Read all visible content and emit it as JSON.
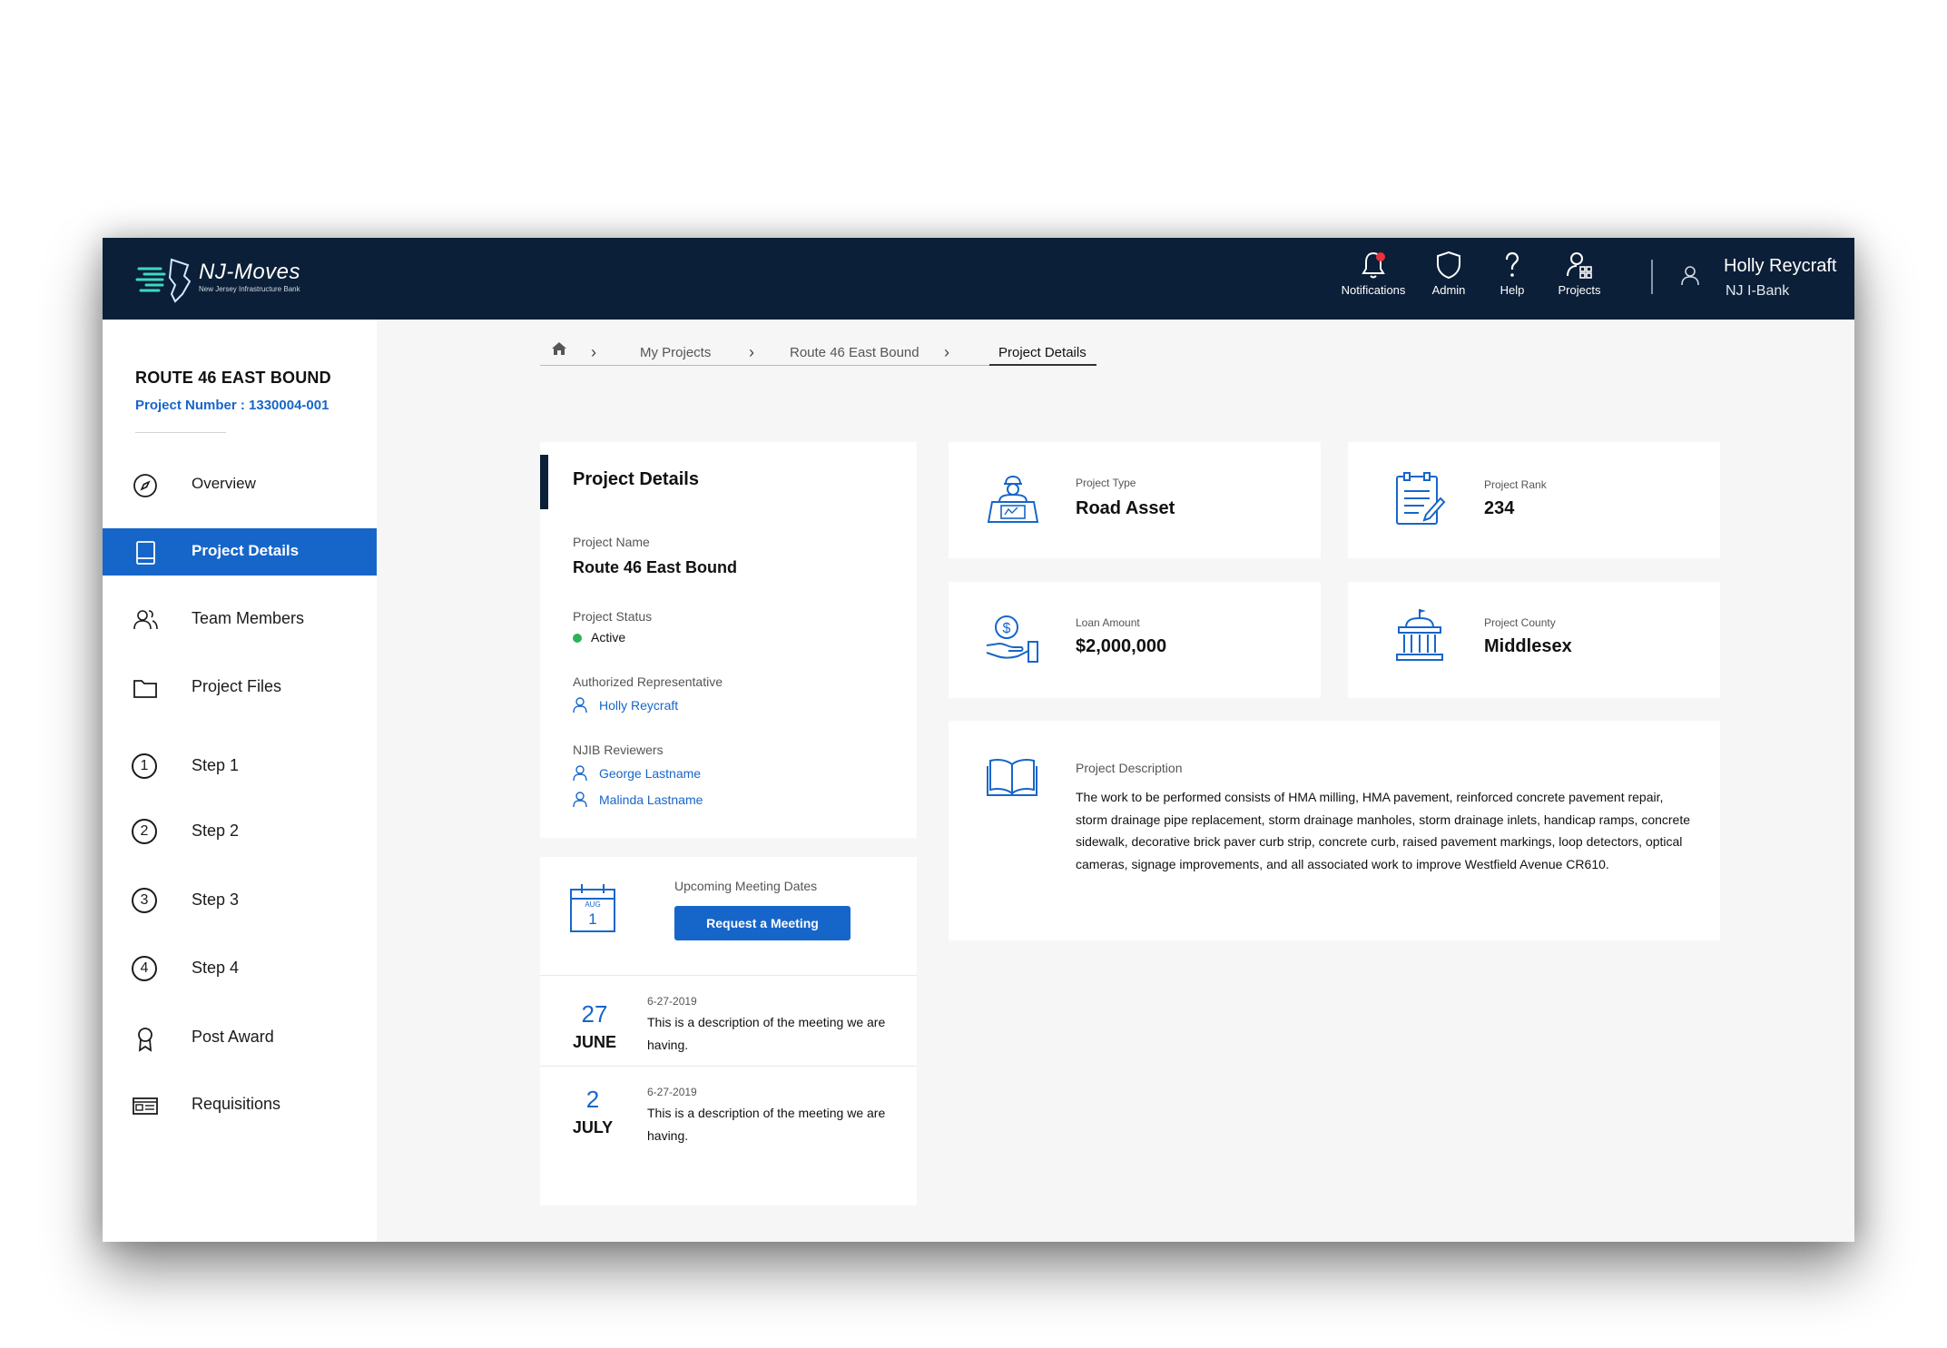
{
  "brand": {
    "name": "NJ-Moves",
    "tagline": "New Jersey Infrastructure Bank"
  },
  "topnav": {
    "items": [
      {
        "label": "Notifications",
        "icon": "bell-icon"
      },
      {
        "label": "Admin",
        "icon": "shield-icon"
      },
      {
        "label": "Help",
        "icon": "question-icon"
      },
      {
        "label": "Projects",
        "icon": "projects-icon"
      }
    ],
    "user": {
      "name": "Holly Reycraft",
      "org": "NJ I-Bank"
    }
  },
  "sidebar": {
    "project_title": "ROUTE 46 EAST BOUND",
    "project_number": "Project Number : 1330004-001",
    "items": [
      {
        "label": "Overview",
        "icon": "compass-icon"
      },
      {
        "label": "Project Details",
        "icon": "book-icon",
        "active": true
      },
      {
        "label": "Team Members",
        "icon": "team-icon"
      },
      {
        "label": "Project Files",
        "icon": "folder-icon"
      },
      {
        "label": "Step 1",
        "step": "1"
      },
      {
        "label": "Step 2",
        "step": "2"
      },
      {
        "label": "Step 3",
        "step": "3"
      },
      {
        "label": "Step 4",
        "step": "4"
      },
      {
        "label": "Post Award",
        "icon": "award-icon"
      },
      {
        "label": "Requisitions",
        "icon": "requisition-icon"
      }
    ]
  },
  "breadcrumb": {
    "items": [
      "My Projects",
      "Route 46 East Bound",
      "Project Details"
    ],
    "home_icon": "home-icon"
  },
  "details": {
    "title": "Project Details",
    "name_label": "Project Name",
    "name_value": "Route 46 East Bound",
    "status_label": "Project Status",
    "status_value": "Active",
    "rep_label": "Authorized Representative",
    "rep_value": "Holly Reycraft",
    "reviewers_label": "NJIB Reviewers",
    "reviewers": [
      "George Lastname",
      "Malinda Lastname"
    ]
  },
  "meetings": {
    "calendar_month": "AUG",
    "calendar_day": "1",
    "label": "Upcoming Meeting Dates",
    "button": "Request a Meeting",
    "items": [
      {
        "day": "27",
        "month": "JUNE",
        "date": "6-27-2019",
        "description": "This is a description of the meeting we are having."
      },
      {
        "day": "2",
        "month": "JULY",
        "date": "6-27-2019",
        "description": "This is a description of the meeting we are having."
      }
    ]
  },
  "info_cards": {
    "type": {
      "label": "Project Type",
      "value": "Road Asset",
      "icon": "worker-plans-icon"
    },
    "rank": {
      "label": "Project Rank",
      "value": "234",
      "icon": "notepad-icon"
    },
    "loan": {
      "label": "Loan Amount",
      "value": "$2,000,000",
      "icon": "hand-money-icon"
    },
    "county": {
      "label": "Project County",
      "value": "Middlesex",
      "icon": "government-building-icon"
    }
  },
  "description": {
    "label": "Project Description",
    "text": "The work to be performed consists of HMA milling, HMA pavement, reinforced concrete pavement repair, storm drainage pipe replacement, storm drainage manholes, storm drainage inlets, handicap ramps, concrete sidewalk, decorative brick paver curb strip, concrete curb, raised pavement markings, loop detectors, optical cameras, signage improvements, and all associated work to improve Westfield Avenue CR610.",
    "icon": "open-book-icon"
  },
  "colors": {
    "navy": "#0c1f38",
    "accent": "#1666c9",
    "status_active": "#2fb15b",
    "notification": "#e8323c"
  }
}
